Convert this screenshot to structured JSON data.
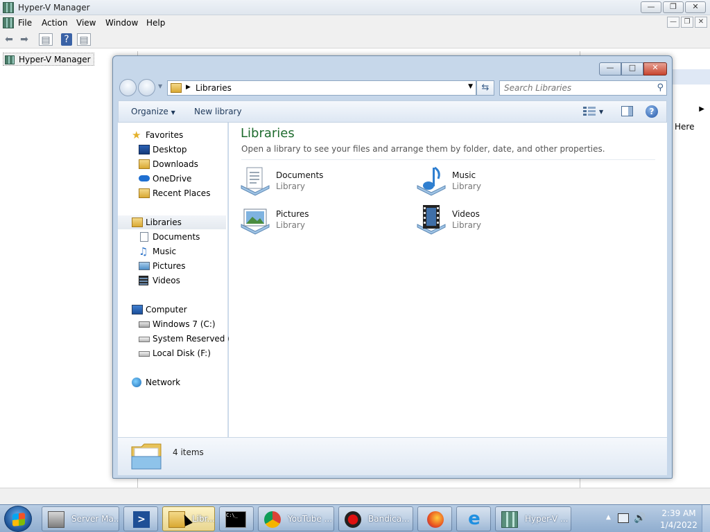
{
  "hyperv": {
    "title": "Hyper-V Manager",
    "menu": [
      "File",
      "Action",
      "View",
      "Window",
      "Help"
    ],
    "tree_root": "Hyper-V Manager",
    "actions_partial_label": "Here"
  },
  "explorer": {
    "address": "Libraries",
    "search_placeholder": "Search Libraries",
    "commands": {
      "organize": "Organize",
      "new_library": "New library"
    },
    "nav": {
      "favorites": {
        "label": "Favorites",
        "items": [
          "Desktop",
          "Downloads",
          "OneDrive",
          "Recent Places"
        ]
      },
      "libraries": {
        "label": "Libraries",
        "items": [
          "Documents",
          "Music",
          "Pictures",
          "Videos"
        ]
      },
      "computer": {
        "label": "Computer",
        "items": [
          "Windows 7 (C:)",
          "System Reserved (D:",
          "Local Disk (F:)"
        ]
      },
      "network": {
        "label": "Network"
      }
    },
    "heading": "Libraries",
    "description": "Open a library to see your files and arrange them by folder, date, and other properties.",
    "libraries": [
      {
        "name": "Documents",
        "type": "Library",
        "icon": "documents-library-icon"
      },
      {
        "name": "Music",
        "type": "Library",
        "icon": "music-library-icon"
      },
      {
        "name": "Pictures",
        "type": "Library",
        "icon": "pictures-library-icon"
      },
      {
        "name": "Videos",
        "type": "Library",
        "icon": "videos-library-icon"
      }
    ],
    "item_count": "4 items"
  },
  "taskbar": {
    "items": [
      {
        "label": "Server Ma...",
        "icon": "server-manager-icon"
      },
      {
        "label": "",
        "icon": "powershell-icon"
      },
      {
        "label": "Libr...",
        "icon": "libraries-folder-icon",
        "active": true
      },
      {
        "label": "",
        "icon": "command-prompt-icon"
      },
      {
        "label": "YouTube ...",
        "icon": "chrome-icon"
      },
      {
        "label": "Bandica...",
        "icon": "bandicam-icon"
      },
      {
        "label": "",
        "icon": "firefox-icon"
      },
      {
        "label": "",
        "icon": "internet-explorer-icon"
      },
      {
        "label": "Hyper-V ...",
        "icon": "hyperv-icon"
      }
    ],
    "time": "2:39 AM",
    "date": "1/4/2022"
  }
}
